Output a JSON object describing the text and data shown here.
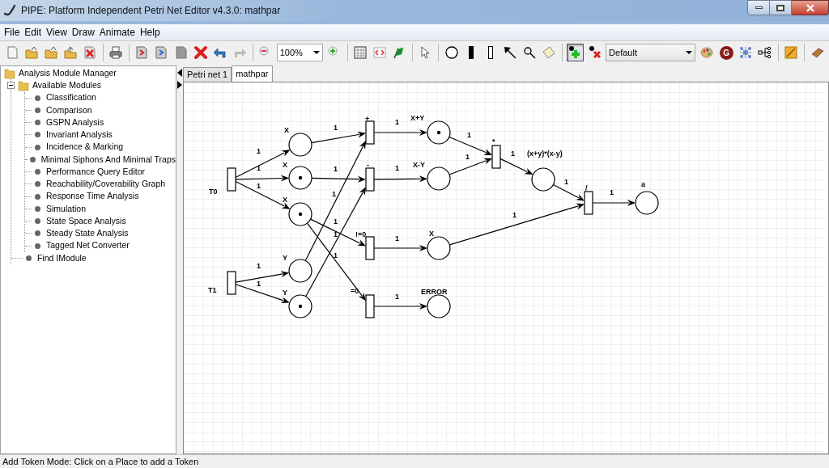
{
  "window": {
    "title": "PIPE: Platform Independent Petri Net Editor v4.3.0: mathpar"
  },
  "menu": [
    "File",
    "Edit",
    "View",
    "Draw",
    "Animate",
    "Help"
  ],
  "toolbar": [
    {
      "kind": "new",
      "selected": false
    },
    {
      "kind": "open",
      "selected": false
    },
    {
      "kind": "open",
      "selected": false
    },
    {
      "kind": "open-all",
      "selected": false
    },
    {
      "kind": "close",
      "selected": false
    },
    {
      "kind": "sep"
    },
    {
      "kind": "print",
      "selected": false
    },
    {
      "kind": "sep"
    },
    {
      "kind": "import",
      "selected": false
    },
    {
      "kind": "export",
      "selected": false
    },
    {
      "kind": "page",
      "selected": false
    },
    {
      "kind": "delete",
      "selected": false
    },
    {
      "kind": "undo",
      "selected": false
    },
    {
      "kind": "redo",
      "selected": false
    },
    {
      "kind": "sep"
    },
    {
      "kind": "zoom-out",
      "selected": false
    },
    {
      "kind": "combo",
      "value": "100%"
    },
    {
      "kind": "zoom-in",
      "selected": false
    },
    {
      "kind": "sep"
    },
    {
      "kind": "grid",
      "selected": false
    },
    {
      "kind": "xml",
      "selected": false
    },
    {
      "kind": "flag",
      "selected": false
    },
    {
      "kind": "sep"
    },
    {
      "kind": "select",
      "selected": false
    },
    {
      "kind": "sep"
    },
    {
      "kind": "place",
      "selected": false
    },
    {
      "kind": "immediate",
      "selected": false
    },
    {
      "kind": "timed",
      "selected": false
    },
    {
      "kind": "arc",
      "selected": false
    },
    {
      "kind": "inhibitor",
      "selected": false
    },
    {
      "kind": "note",
      "selected": false
    },
    {
      "kind": "sep"
    },
    {
      "kind": "add-token",
      "selected": true
    },
    {
      "kind": "remove-token",
      "selected": false
    },
    {
      "kind": "combo",
      "value": "Default"
    },
    {
      "kind": "palette",
      "selected": false
    },
    {
      "kind": "g",
      "label": "G",
      "selected": false
    },
    {
      "kind": "network",
      "selected": false
    },
    {
      "kind": "tree",
      "selected": false
    },
    {
      "kind": "sep"
    },
    {
      "kind": "animate",
      "selected": false
    },
    {
      "kind": "sep"
    },
    {
      "kind": "eraser",
      "selected": false
    }
  ],
  "tree": {
    "label": "Analysis Module Manager",
    "expanded": true,
    "children": [
      {
        "label": "Available Modules",
        "expanded": true,
        "children": [
          {
            "label": "Classification"
          },
          {
            "label": "Comparison"
          },
          {
            "label": "GSPN Analysis"
          },
          {
            "label": "Invariant Analysis"
          },
          {
            "label": "Incidence & Marking"
          },
          {
            "label": "Minimal Siphons And Minimal Traps"
          },
          {
            "label": "Performance Query Editor"
          },
          {
            "label": "Reachability/Coverability Graph"
          },
          {
            "label": "Response Time Analysis"
          },
          {
            "label": "Simulation"
          },
          {
            "label": "State Space Analysis"
          },
          {
            "label": "Steady State Analysis"
          },
          {
            "label": "Tagged Net Converter"
          }
        ]
      },
      {
        "label": "Find IModule"
      }
    ]
  },
  "tabs": [
    {
      "label": "Petri net 1",
      "selected": false
    },
    {
      "label": "mathpar",
      "selected": true
    }
  ],
  "net": {
    "places": [
      {
        "label": "X",
        "marked": false
      },
      {
        "label": "X",
        "marked": true
      },
      {
        "label": "X",
        "marked": true
      },
      {
        "label": "Y",
        "marked": false
      },
      {
        "label": "Y",
        "marked": true
      },
      {
        "label": "X+Y",
        "marked": true
      },
      {
        "label": "X-Y",
        "marked": false
      },
      {
        "label": "X",
        "marked": false
      },
      {
        "label": "ERROR",
        "marked": false
      },
      {
        "label": "(x+y)*(x-y)",
        "marked": false
      },
      {
        "label": "a",
        "marked": false
      }
    ],
    "transitions": [
      {
        "label": "T0"
      },
      {
        "label": "T1"
      },
      {
        "label": "+"
      },
      {
        "label": "-"
      },
      {
        "label": "!=0"
      },
      {
        "label": "=0"
      },
      {
        "label": "*"
      },
      {
        "label": "/"
      }
    ],
    "arcs": [
      {
        "weight": "1"
      },
      {
        "weight": "1"
      },
      {
        "weight": "1"
      },
      {
        "weight": "1"
      },
      {
        "weight": "1"
      },
      {
        "weight": "1"
      },
      {
        "weight": "1"
      },
      {
        "weight": "1"
      },
      {
        "weight": "1"
      },
      {
        "weight": "1"
      },
      {
        "weight": "1"
      },
      {
        "weight": "1"
      },
      {
        "weight": "1"
      },
      {
        "weight": "1"
      },
      {
        "weight": "1"
      },
      {
        "weight": "1"
      },
      {
        "weight": "1"
      },
      {
        "weight": "1"
      },
      {
        "weight": "1"
      },
      {
        "weight": "1"
      },
      {
        "weight": "1"
      }
    ]
  },
  "status_bar": "Add Token Mode: Click on a Place to add a Token"
}
